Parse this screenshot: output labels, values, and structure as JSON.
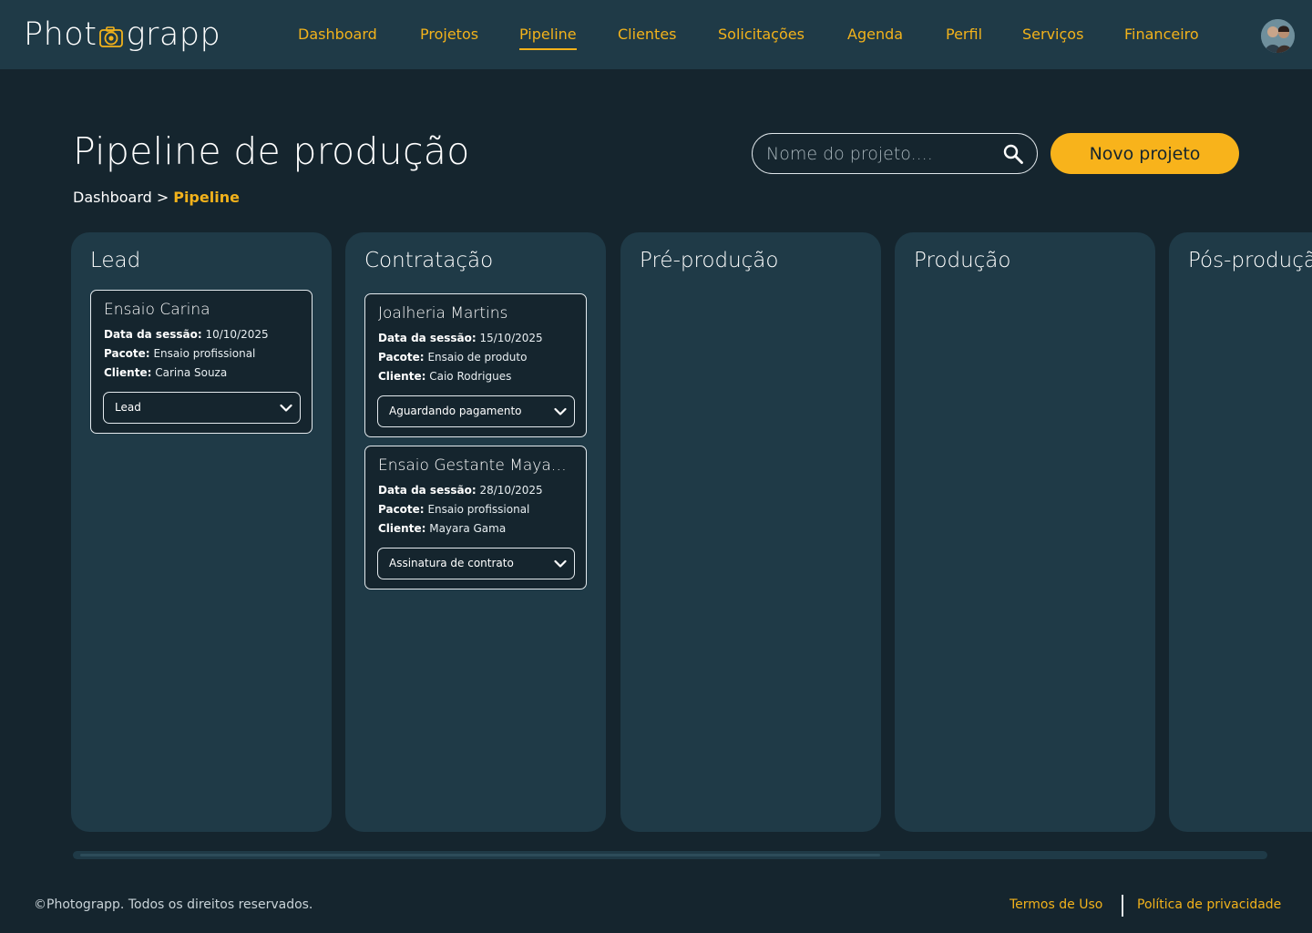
{
  "header": {
    "logo_left": "Phot",
    "logo_right": "grapp",
    "nav": [
      {
        "label": "Dashboard",
        "active": false
      },
      {
        "label": "Projetos",
        "active": false
      },
      {
        "label": "Pipeline",
        "active": true
      },
      {
        "label": "Clientes",
        "active": false
      },
      {
        "label": "Solicitações",
        "active": false
      },
      {
        "label": "Agenda",
        "active": false
      },
      {
        "label": "Perfil",
        "active": false
      },
      {
        "label": "Serviços",
        "active": false
      },
      {
        "label": "Financeiro",
        "active": false
      }
    ]
  },
  "main": {
    "title": "Pipeline de produção",
    "breadcrumb": {
      "parent": "Dashboard",
      "separator": ">",
      "current": "Pipeline"
    },
    "search": {
      "placeholder": "Nome do projeto...."
    },
    "new_button": "Novo projeto"
  },
  "labels": {
    "session_date": "Data da sessão:",
    "package": "Pacote:",
    "client": "Cliente:"
  },
  "columns": [
    {
      "title": "Lead",
      "cards": [
        {
          "title": "Ensaio Carina",
          "date": "10/10/2025",
          "package": "Ensaio profissional",
          "client": "Carina Souza",
          "status": "Lead"
        }
      ]
    },
    {
      "title": "Contratação",
      "cards": [
        {
          "title": "Joalheria Martins",
          "date": "15/10/2025",
          "package": "Ensaio de produto",
          "client": "Caio Rodrigues",
          "status": "Aguardando pagamento"
        },
        {
          "title": "Ensaio Gestante Mayar...",
          "date": "28/10/2025",
          "package": "Ensaio profissional",
          "client": "Mayara Gama",
          "status": "Assinatura de contrato"
        }
      ]
    },
    {
      "title": "Pré-produção",
      "cards": []
    },
    {
      "title": "Produção",
      "cards": []
    },
    {
      "title": "Pós-produção",
      "cards": []
    }
  ],
  "footer": {
    "copyright": "©Photograpp. Todos os direitos reservados.",
    "terms": "Termos de Uso",
    "privacy": "Política de privacidade"
  },
  "colors": {
    "background": "#15252e",
    "panel": "#1f3a47",
    "accent": "#f2b21b",
    "button": "#f8b31b"
  }
}
